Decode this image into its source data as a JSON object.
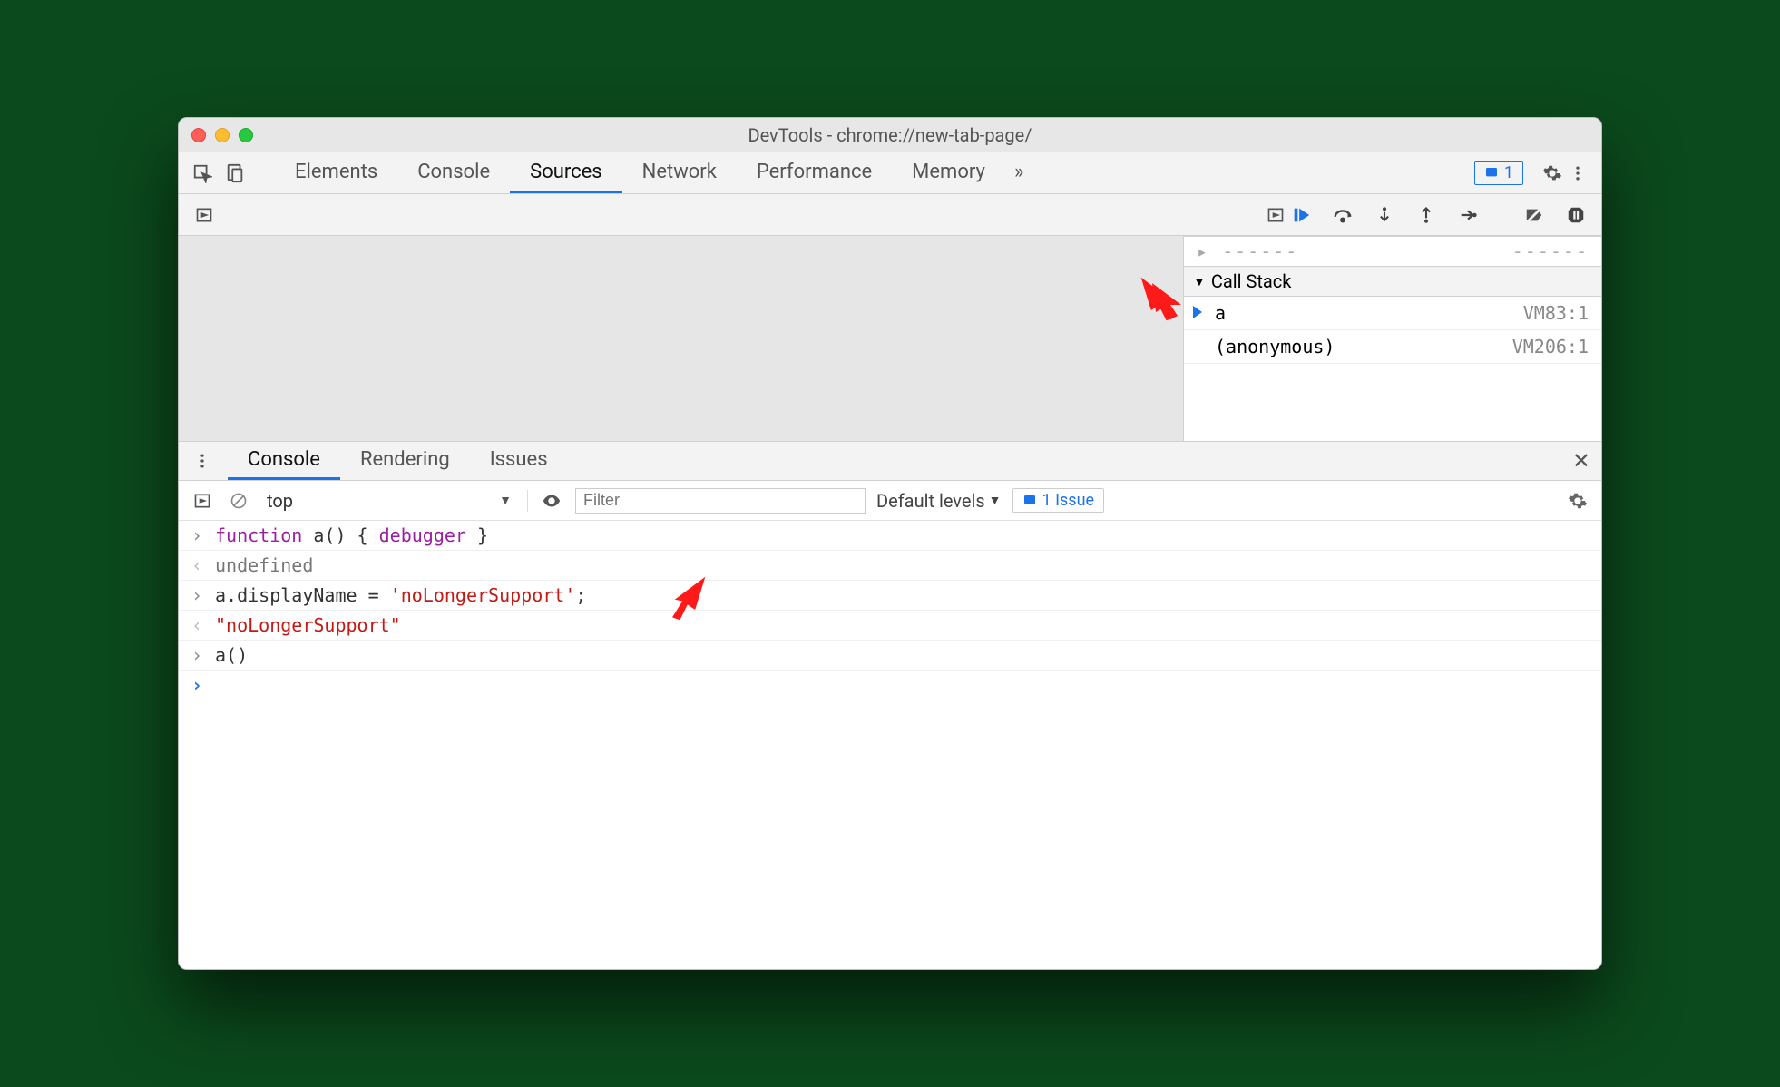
{
  "window": {
    "title": "DevTools - chrome://new-tab-page/"
  },
  "top_tabs": {
    "items": [
      "Elements",
      "Console",
      "Sources",
      "Network",
      "Performance",
      "Memory"
    ],
    "active_index": 2,
    "more_indicator": "»",
    "issue_count": "1"
  },
  "debug_pane": {
    "scope_truncated": {
      "label": "",
      "value": ""
    },
    "callstack_label": "Call Stack",
    "frames": [
      {
        "name": "a",
        "loc": "VM83:1",
        "active": true
      },
      {
        "name": "(anonymous)",
        "loc": "VM206:1",
        "active": false
      }
    ]
  },
  "drawer": {
    "tabs": [
      "Console",
      "Rendering",
      "Issues"
    ],
    "active_index": 0
  },
  "console_toolbar": {
    "context": "top",
    "filter_placeholder": "Filter",
    "levels": "Default levels",
    "issue_button": "1 Issue"
  },
  "console_lines": [
    {
      "type": "in",
      "segments": [
        {
          "t": "function ",
          "cls": "kw"
        },
        {
          "t": "a",
          "cls": "fn"
        },
        {
          "t": "() { ",
          "cls": "punct"
        },
        {
          "t": "debugger",
          "cls": "debugger"
        },
        {
          "t": " }",
          "cls": "punct"
        }
      ]
    },
    {
      "type": "out",
      "segments": [
        {
          "t": "undefined",
          "cls": "undef"
        }
      ]
    },
    {
      "type": "in",
      "segments": [
        {
          "t": "a.displayName ",
          "cls": "prop"
        },
        {
          "t": "= ",
          "cls": "punct"
        },
        {
          "t": "'noLongerSupport'",
          "cls": "str"
        },
        {
          "t": ";",
          "cls": "punct"
        }
      ]
    },
    {
      "type": "out",
      "segments": [
        {
          "t": "\"noLongerSupport\"",
          "cls": "str"
        }
      ]
    },
    {
      "type": "in",
      "segments": [
        {
          "t": "a()",
          "cls": "prop"
        }
      ]
    },
    {
      "type": "prompt",
      "segments": []
    }
  ],
  "annotations": {
    "arrow1": "↘",
    "arrow2": "↙"
  }
}
